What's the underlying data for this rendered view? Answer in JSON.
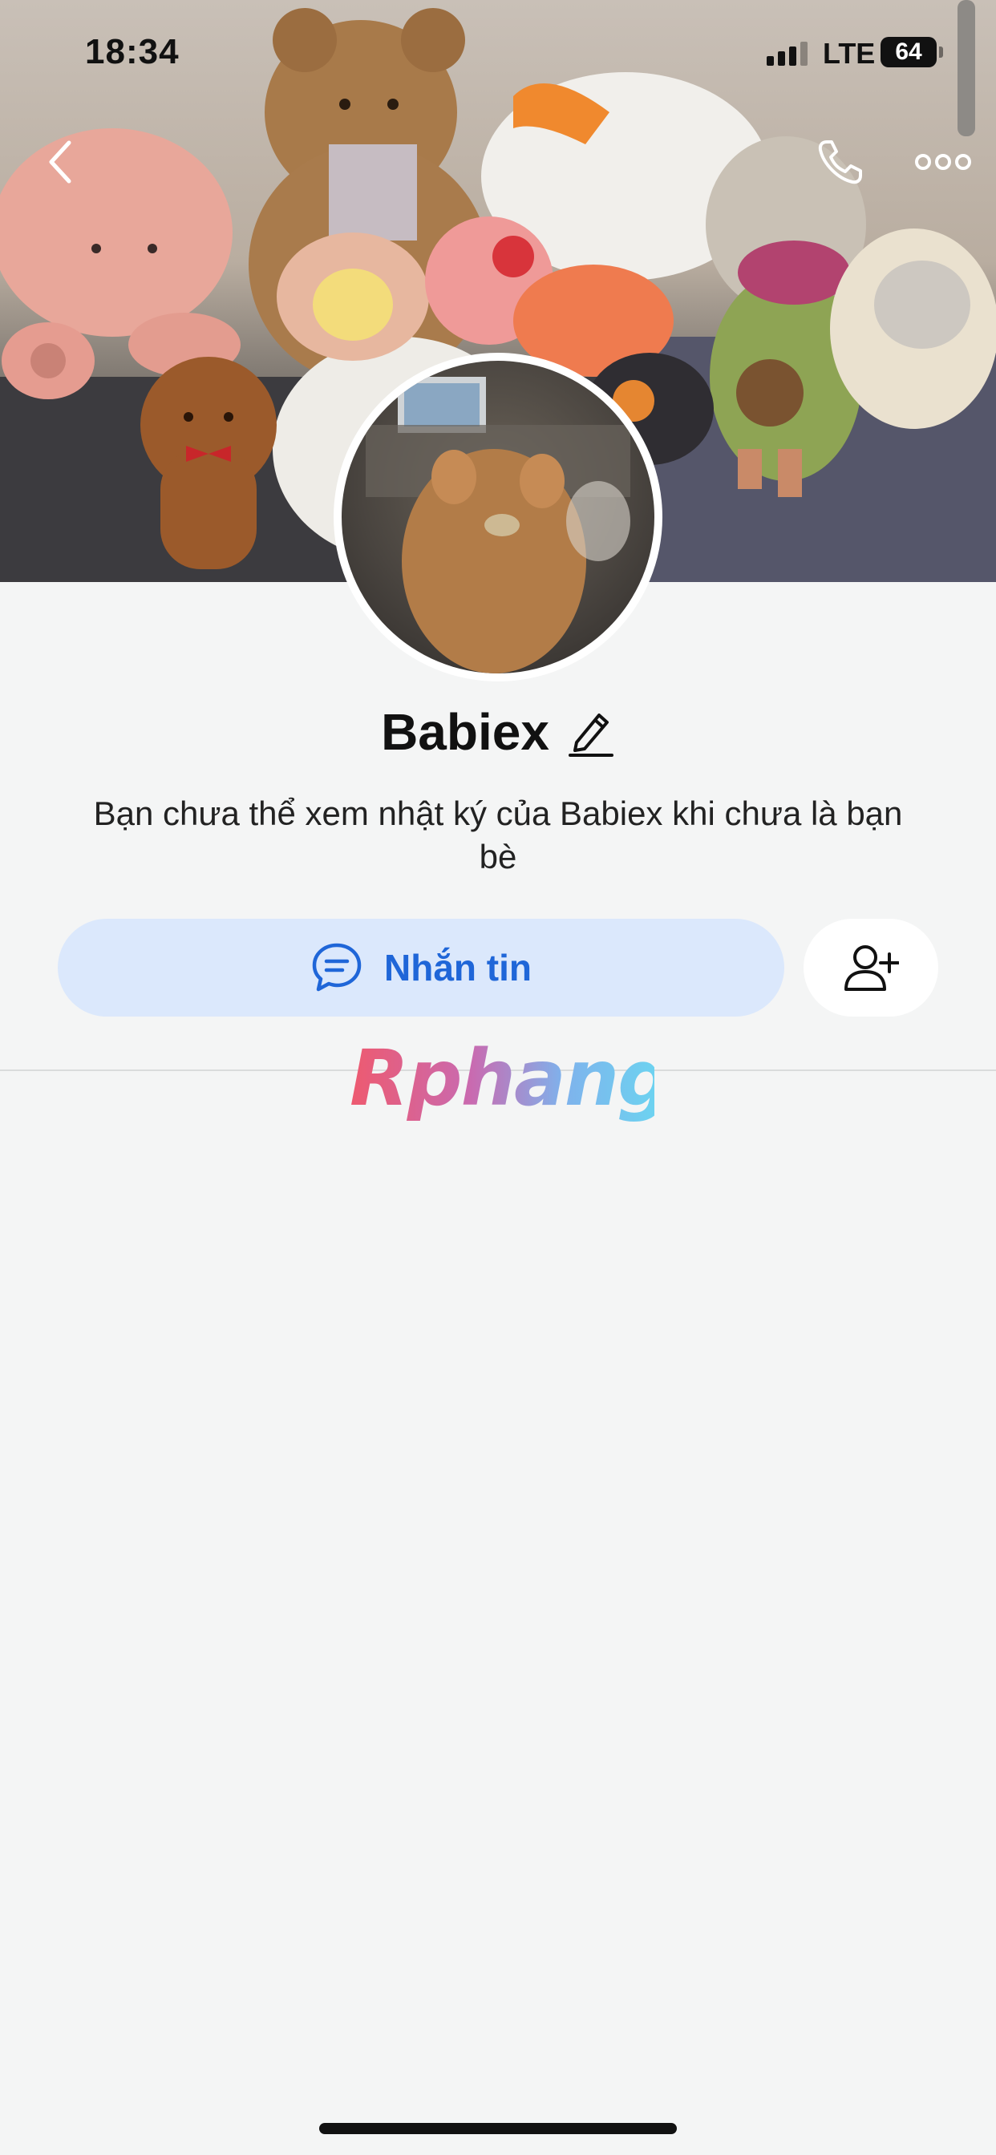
{
  "status_bar": {
    "time": "18:34",
    "network": "LTE",
    "battery": "64"
  },
  "nav": {
    "back_icon": "chevron-left-icon",
    "call_icon": "phone-icon",
    "more_icon": "more-dots-icon"
  },
  "profile": {
    "name": "Babiex",
    "edit_icon": "pencil-icon",
    "privacy_notice": "Bạn chưa thể xem nhật ký của Babiex khi chưa là bạn bè"
  },
  "actions": {
    "message_label": "Nhắn tin",
    "message_icon": "chat-bubble-icon",
    "add_friend_icon": "add-friend-icon"
  },
  "watermark": "Rphang",
  "colors": {
    "background": "#f4f5f5",
    "accent": "#1f66d8",
    "message_button_bg": "#dbe8fc"
  }
}
